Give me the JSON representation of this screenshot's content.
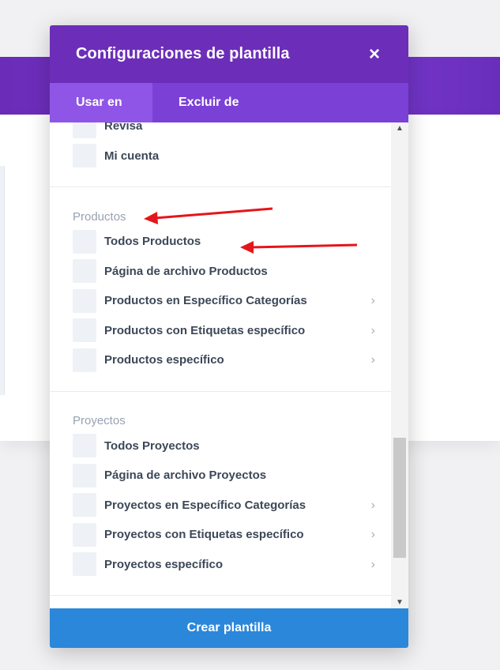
{
  "modal": {
    "title": "Configuraciones de plantilla",
    "close_icon": "×",
    "tabs": [
      {
        "label": "Usar en",
        "active": true
      },
      {
        "label": "Excluir de",
        "active": false
      }
    ],
    "top_items": [
      {
        "label": "Revisa"
      },
      {
        "label": "Mi cuenta"
      }
    ],
    "sections": [
      {
        "title": "Productos",
        "items": [
          {
            "label": "Todos Productos",
            "has_submenu": false
          },
          {
            "label": "Página de archivo Productos",
            "has_submenu": false
          },
          {
            "label": "Productos en Específico Categorías",
            "has_submenu": true
          },
          {
            "label": "Productos con Etiquetas específico",
            "has_submenu": true
          },
          {
            "label": "Productos específico",
            "has_submenu": true
          }
        ]
      },
      {
        "title": "Proyectos",
        "items": [
          {
            "label": "Todos Proyectos",
            "has_submenu": false
          },
          {
            "label": "Página de archivo Proyectos",
            "has_submenu": false
          },
          {
            "label": "Proyectos en Específico Categorías",
            "has_submenu": true
          },
          {
            "label": "Proyectos con Etiquetas específico",
            "has_submenu": true
          },
          {
            "label": "Proyectos específico",
            "has_submenu": true
          }
        ]
      }
    ],
    "footer_button": "Crear plantilla"
  },
  "colors": {
    "header": "#6c2eb9",
    "tabs": "#7b40d6",
    "active_tab": "#8f55e6",
    "footer": "#2b87da",
    "annotation_arrow": "#e4161b"
  }
}
